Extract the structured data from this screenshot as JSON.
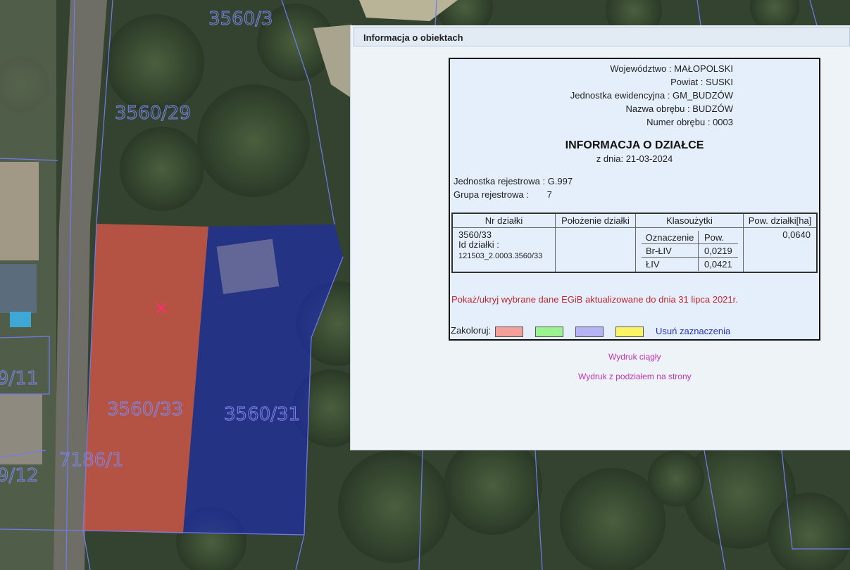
{
  "map": {
    "parcel_labels": [
      "3560/3",
      "3560/29",
      "3560/33",
      "3560/31",
      "7186/1",
      "9/11",
      "9/12"
    ],
    "colors": {
      "selected_fill": "#d9584a",
      "neighbour_fill": "#1c2ab8",
      "boundary": "#6f7cf0",
      "marker": "#ff2d6f"
    }
  },
  "panel": {
    "title": "Informacja o obiektach",
    "meta": [
      {
        "label": "Województwo :",
        "value": "MAŁOPOLSKI"
      },
      {
        "label": "Powiat :",
        "value": "SUSKI"
      },
      {
        "label": "Jednostka ewidencyjna :",
        "value": "GM_BUDZÓW"
      },
      {
        "label": "Nazwa obrębu :",
        "value": "BUDZÓW"
      },
      {
        "label": "Numer obrębu :",
        "value": "0003"
      }
    ],
    "doc_title": "INFORMACJA O DZIAŁCE",
    "doc_date": "z dnia: 21-03-2024",
    "registry": [
      {
        "label": "Jednostka rejestrowa :",
        "value": "G.997"
      },
      {
        "label": "Grupa rejestrowa :",
        "value": "7"
      }
    ],
    "table": {
      "headers": [
        "Nr działki",
        "Położenie działki",
        "Klasoużytki",
        "Pow. działki[ha]"
      ],
      "parcel_number": "3560/33",
      "parcel_id_label": "Id działki :",
      "parcel_id": "121503_2.0003.3560/33",
      "location": "",
      "sub_headers": [
        "Oznaczenie",
        "Pow."
      ],
      "land_use": [
        {
          "code": "Br-ŁIV",
          "area": "0,0219"
        },
        {
          "code": "ŁIV",
          "area": "0,0421"
        }
      ],
      "area": "0,0640"
    },
    "egib_link": "Pokaż/ukryj wybrane dane EGiB aktualizowane do dnia 31 lipca 2021r.",
    "colorize_label": "Zakoloruj:",
    "swatch_colors": [
      "#f4a09a",
      "#99f38f",
      "#b5b2f6",
      "#fbf564"
    ],
    "clear_label": "Usuń zaznaczenia",
    "print_continuous": "Wydruk ciągły",
    "print_pages": "Wydruk z podziałem na strony"
  }
}
